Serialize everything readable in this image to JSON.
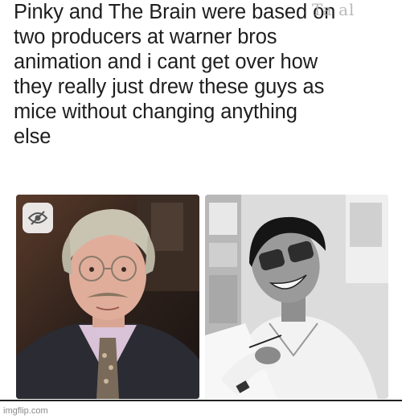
{
  "caption": {
    "lines": [
      "Pinky and The Brain were based on",
      "two producers at warner bros",
      "animation and i cant get over how",
      "they really just drew these guys as",
      "mice without changing anything",
      "else"
    ]
  },
  "watermark": "Ta al",
  "photos": {
    "left_icon": "eye-slash-icon"
  },
  "footer": {
    "site": "imgflip.com"
  },
  "colors": {
    "text": "#1e1e1e",
    "footer_text": "#8a8a8a",
    "divider": "#222222"
  }
}
